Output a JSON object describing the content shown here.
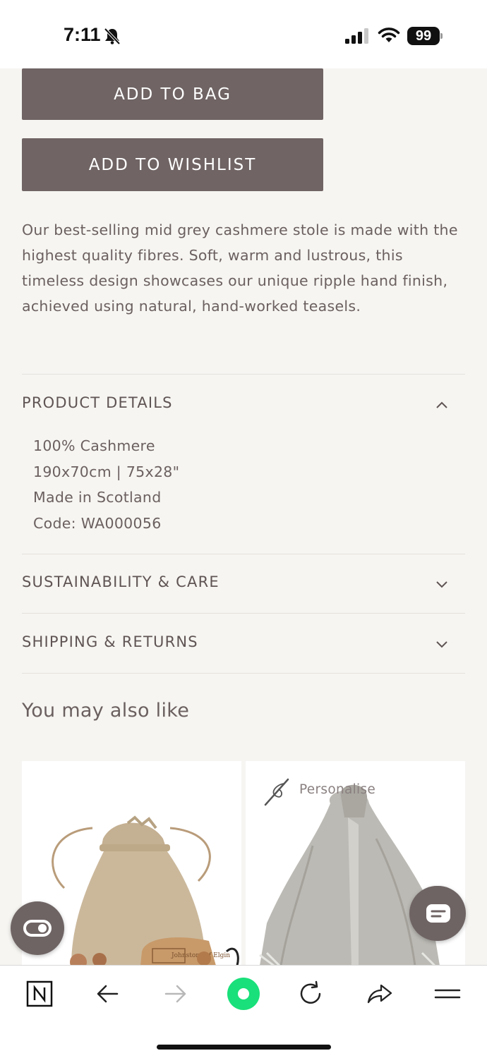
{
  "status_bar": {
    "time": "7:11",
    "battery": "99"
  },
  "actions": {
    "add_to_bag": "ADD TO BAG",
    "add_to_wishlist": "ADD TO WISHLIST"
  },
  "description": "Our best-selling mid grey cashmere stole is made with the highest quality fibres. Soft, warm and lustrous, this timeless design showcases our unique ripple hand finish, achieved using natural, hand-worked teasels.",
  "accordion": {
    "product_details": {
      "title": "PRODUCT DETAILS",
      "expanded": true,
      "lines": [
        "100% Cashmere",
        "190x70cm | 75x28\"",
        "Made in Scotland",
        "Code: WA000056"
      ]
    },
    "sustainability": {
      "title": "SUSTAINABILITY & CARE",
      "expanded": false
    },
    "shipping": {
      "title": "SHIPPING & RETURNS",
      "expanded": false
    }
  },
  "recommendations": {
    "heading": "You may also like",
    "cards": [
      {
        "image": "jute-gift-bag-with-wooden-teasel-brush",
        "logo_text": "Johnstons of Elgin"
      },
      {
        "image": "grey-cashmere-scarf",
        "badge": "Personalise"
      }
    ]
  },
  "browser_toolbar": {
    "icons": [
      "notion-n-icon",
      "back-arrow-icon",
      "forward-arrow-icon",
      "browser-home-icon",
      "reload-icon",
      "share-icon",
      "menu-icon"
    ]
  },
  "colors": {
    "button_bg": "#706464",
    "page_bg": "#f6f5f2",
    "accent_green": "#19e07a"
  }
}
